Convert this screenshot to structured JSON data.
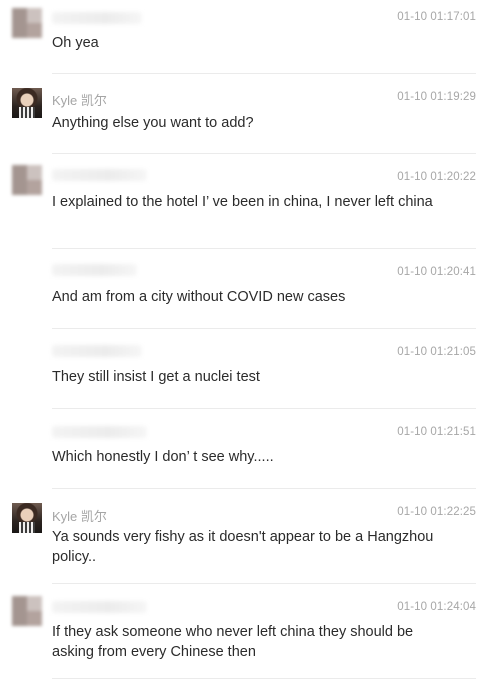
{
  "messages": [
    {
      "sender": "",
      "time": "01-10 01:17:01",
      "text": "Oh yea",
      "avatar": "blurred-avatar"
    },
    {
      "sender": "Kyle 凯尔",
      "time": "01-10 01:19:29",
      "text": "Anything else you want to add?",
      "avatar": "kyle-avatar"
    },
    {
      "sender": "",
      "time": "01-10 01:20:22",
      "text": "I explained to the hotel I’ ve been in china, I never left china",
      "avatar": "blurred-avatar"
    },
    {
      "sender": "",
      "time": "01-10 01:20:41",
      "text": "And am from a city without COVID new cases",
      "avatar": ""
    },
    {
      "sender": "",
      "time": "01-10 01:21:05",
      "text": "They still insist I get a nuclei test",
      "avatar": ""
    },
    {
      "sender": "",
      "time": "01-10 01:21:51",
      "text": "Which honestly I don’ t see why.....",
      "avatar": ""
    },
    {
      "sender": "Kyle 凯尔",
      "time": "01-10 01:22:25",
      "text": "Ya sounds very fishy as it doesn't appear to be a Hangzhou policy..",
      "avatar": "kyle-avatar"
    },
    {
      "sender": "",
      "time": "01-10 01:24:04",
      "text": "If they ask someone who never left china they should be asking from every Chinese then",
      "avatar": "blurred-avatar"
    }
  ]
}
